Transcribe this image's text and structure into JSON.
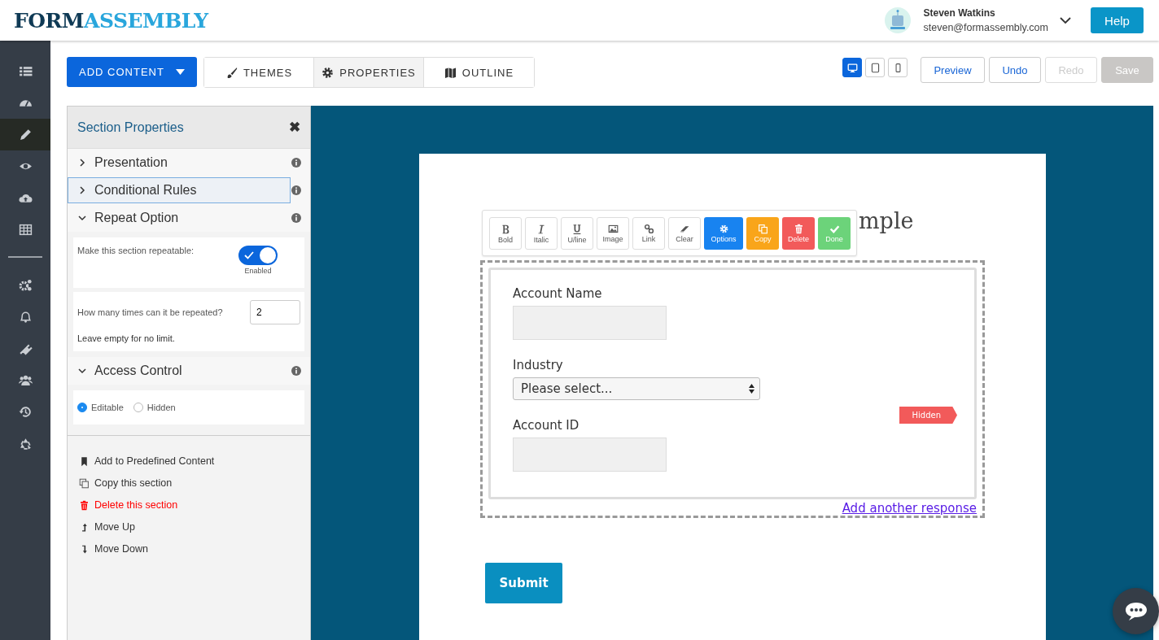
{
  "header": {
    "logo": {
      "dark": "FORM",
      "light": "ASSEMBLY"
    },
    "user": {
      "name": "Steven Watkins",
      "email": "steven@formassembly.com"
    },
    "help": "Help"
  },
  "nav_groups": [
    [
      {
        "kind": "list",
        "selected": false
      },
      {
        "kind": "gauge",
        "selected": false
      },
      {
        "kind": "pencil",
        "selected": true
      },
      {
        "kind": "eye",
        "selected": false
      },
      {
        "kind": "cloud",
        "selected": false
      },
      {
        "kind": "table",
        "selected": false
      }
    ],
    [
      {
        "kind": "gears",
        "selected": false
      },
      {
        "kind": "bell",
        "selected": false
      },
      {
        "kind": "plug",
        "selected": false
      },
      {
        "kind": "users",
        "selected": false
      },
      {
        "kind": "history",
        "selected": false
      },
      {
        "kind": "recycle",
        "selected": false
      }
    ]
  ],
  "toolbar": {
    "add_content": "ADD CONTENT",
    "tabs": [
      {
        "label": "THEMES",
        "kind": "brush",
        "selected": false
      },
      {
        "label": "PROPERTIES",
        "kind": "gear",
        "selected": true
      },
      {
        "label": "OUTLINE",
        "kind": "map",
        "selected": false
      }
    ],
    "devices": [
      {
        "kind": "desktop",
        "selected": true
      },
      {
        "kind": "tablet",
        "selected": false
      },
      {
        "kind": "phone",
        "selected": false
      }
    ],
    "actions": [
      {
        "label": "Preview",
        "kind": "outline",
        "disabled": false
      },
      {
        "label": "Undo",
        "kind": "outline",
        "disabled": false
      },
      {
        "label": "Redo",
        "kind": "outline",
        "disabled": true
      },
      {
        "label": "Save",
        "kind": "solid",
        "disabled": true
      }
    ]
  },
  "panel": {
    "title": "Section Properties",
    "close": "✖",
    "sections": [
      {
        "title": "Presentation",
        "expanded": false,
        "focused": false
      },
      {
        "title": "Conditional Rules",
        "expanded": false,
        "focused": true
      },
      {
        "title": "Repeat Option",
        "expanded": true,
        "focused": false,
        "kind": "repeat",
        "toggle_label": "Make this section repeatable:",
        "toggle": {
          "on": true,
          "caption": "Enabled"
        },
        "count_label": "How many times can it be repeated?",
        "count_value": "2",
        "hint": "Leave empty for no limit."
      },
      {
        "title": "Access Control",
        "expanded": true,
        "focused": false,
        "kind": "access",
        "options": [
          {
            "label": "Editable",
            "selected": true
          },
          {
            "label": "Hidden",
            "selected": false
          }
        ]
      }
    ],
    "actions": [
      {
        "label": "Add to Predefined Content",
        "kind": "bookmark"
      },
      {
        "label": "Copy this section",
        "kind": "copy"
      },
      {
        "label": "Delete this section",
        "kind": "delete"
      },
      {
        "label": "Move Up",
        "kind": "up"
      },
      {
        "label": "Move Down",
        "kind": "down"
      }
    ]
  },
  "form": {
    "title": "mple",
    "editor_toolbar": [
      {
        "label": "Bold",
        "kind": "bold"
      },
      {
        "label": "Italic",
        "kind": "italic"
      },
      {
        "label": "U/line",
        "kind": "underline"
      },
      {
        "label": "Image",
        "kind": "image"
      },
      {
        "label": "Link",
        "kind": "link"
      },
      {
        "label": "Clear",
        "kind": "clear"
      },
      {
        "label": "Options",
        "kind": "options"
      },
      {
        "label": "Copy",
        "kind": "copy"
      },
      {
        "label": "Delete",
        "kind": "delete"
      },
      {
        "label": "Done",
        "kind": "done"
      }
    ],
    "fields": [
      {
        "label": "Account Name",
        "kind": "text"
      },
      {
        "label": "Industry",
        "kind": "select",
        "value": "Please select..."
      },
      {
        "label": "Account ID",
        "kind": "text"
      }
    ],
    "hidden_badge": "Hidden",
    "add_link": "Add another response",
    "submit": "Submit"
  }
}
